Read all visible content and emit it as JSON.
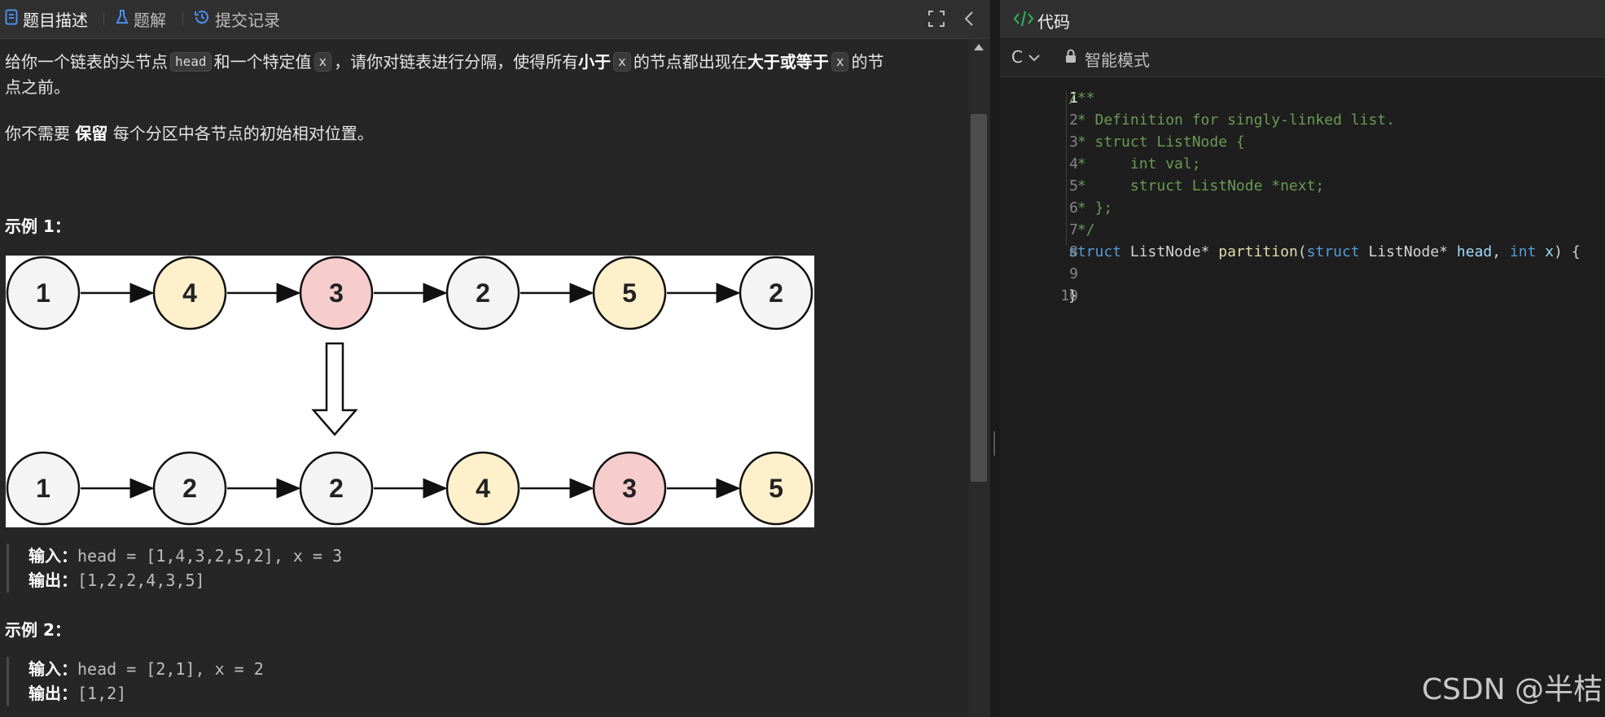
{
  "tabs": [
    {
      "label": "题目描述",
      "icon": "document-icon"
    },
    {
      "label": "题解",
      "icon": "flask-icon"
    },
    {
      "label": "提交记录",
      "icon": "history-icon"
    }
  ],
  "description": {
    "line1_a": "给你一个链表的头节点",
    "line1_code1": "head",
    "line1_b": "和一个特定值",
    "line1_code2": "x",
    "line1_c": "，请你对链表进行分隔，使得所有",
    "line1_bold1": "小于",
    "line1_code3": "x",
    "line1_d": "的节点都出现在",
    "line1_bold2": "大于或等于",
    "line1_code4": "x",
    "line1_e": "的节",
    "line2": "点之前。",
    "line3_a": "你不需要",
    "line3_bold": "保留",
    "line3_b": "每个分区中各节点的初始相对位置。"
  },
  "example1": {
    "heading": "示例 1：",
    "input_label": "输入：",
    "input_value": "head = [1,4,3,2,5,2], x = 3",
    "output_label": "输出：",
    "output_value": "[1,2,2,4,3,5]"
  },
  "example2": {
    "heading": "示例 2：",
    "input_label": "输入：",
    "input_value": "head = [2,1], x = 2",
    "output_label": "输出：",
    "output_value": "[1,2]"
  },
  "diagram": {
    "top_row": [
      "1",
      "4",
      "3",
      "2",
      "5",
      "2"
    ],
    "bottom_row": [
      "1",
      "2",
      "2",
      "4",
      "3",
      "5"
    ],
    "colors": {
      "gray": "#f4f4f4",
      "yellow": "#fff0cc",
      "red": "#f6cccc"
    },
    "top_colors": [
      "gray",
      "yellow",
      "red",
      "gray",
      "yellow",
      "gray"
    ],
    "bottom_colors": [
      "gray",
      "gray",
      "gray",
      "yellow",
      "red",
      "yellow"
    ]
  },
  "editor": {
    "title": "代码",
    "language": "C",
    "mode": "智能模式",
    "line_numbers": [
      "1",
      "2",
      "3",
      "4",
      "5",
      "6",
      "7",
      "8",
      "9",
      "10"
    ],
    "lines": [
      "/**",
      " * Definition for singly-linked list.",
      " * struct ListNode {",
      " *     int val;",
      " *     struct ListNode *next;",
      " * };",
      " */",
      "",
      "",
      "}"
    ],
    "line8": {
      "kw1": "struct",
      "t1": " ListNode* ",
      "fn": "partition",
      "t2": "(",
      "kw2": "struct",
      "t3": " ListNode* ",
      "p1": "head",
      "t4": ", ",
      "kw3": "int",
      "t5": " ",
      "p2": "x",
      "t6": ") {"
    }
  },
  "watermark": "CSDN @半桔"
}
